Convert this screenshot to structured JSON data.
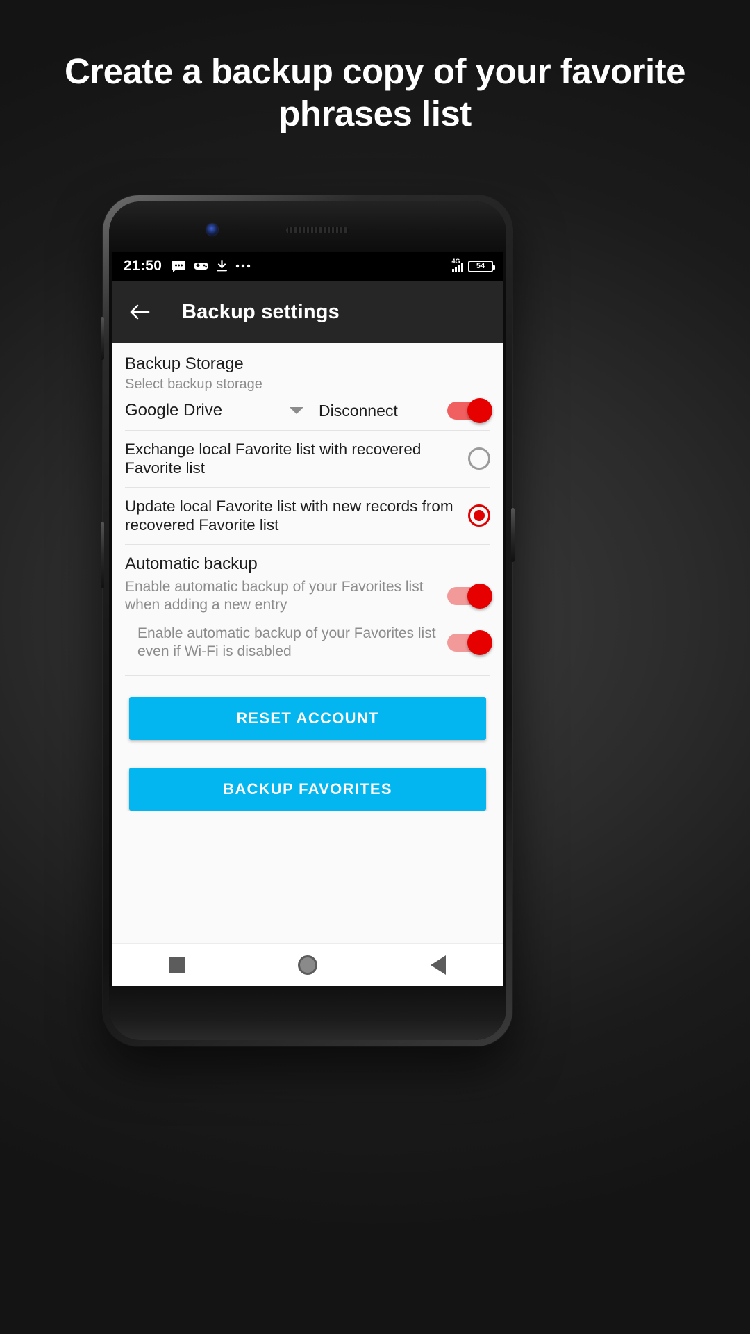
{
  "headline": "Create a backup copy of your favorite phrases list",
  "status_bar": {
    "time": "21:50",
    "left_icons": [
      "message-icon",
      "game-controller-icon",
      "download-icon",
      "more-icon"
    ],
    "signal_label": "4G",
    "battery_percent": "54"
  },
  "app_bar": {
    "back_icon": "back-arrow-icon",
    "title": "Backup settings"
  },
  "backup_storage": {
    "title": "Backup Storage",
    "subtitle": "Select backup storage",
    "selected_storage": "Google Drive",
    "storage_options": [
      "Google Drive"
    ],
    "disconnect_label": "Disconnect",
    "disconnect_toggle_on": true
  },
  "restore_mode": {
    "options": [
      {
        "label": "Exchange local Favorite list with recovered Favorite list",
        "selected": false
      },
      {
        "label": "Update local Favorite list with new records from recovered Favorite list",
        "selected": true
      }
    ]
  },
  "automatic_backup": {
    "title": "Automatic backup",
    "items": [
      {
        "label": "Enable automatic backup of your Favorites list when adding a new entry",
        "on": true
      },
      {
        "label": "Enable automatic backup of your Favorites list even if Wi-Fi is disabled",
        "on": true
      }
    ]
  },
  "actions": {
    "reset_account_label": "RESET ACCOUNT",
    "backup_favorites_label": "BACKUP FAVORITES"
  },
  "nav_bar": {
    "recents_icon": "square-recents-icon",
    "home_icon": "circle-home-icon",
    "back_icon": "triangle-back-icon"
  },
  "colors": {
    "accent": "#03b6f0",
    "toggle_on": "#e60000",
    "radio_selected": "#e00000",
    "appbar_bg": "#262626"
  }
}
